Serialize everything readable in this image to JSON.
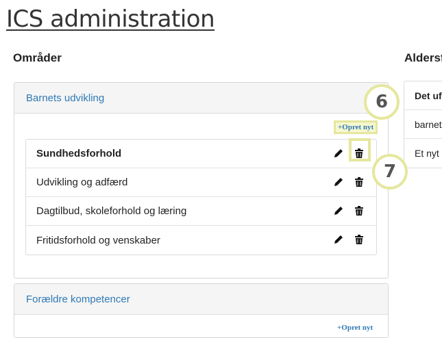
{
  "page": {
    "title": "ICS administration"
  },
  "sections": {
    "areas_heading": "Områder",
    "age_heading": "Aldersf"
  },
  "panels": [
    {
      "title": "Barnets udvikling",
      "create_label": "+Opret nyt",
      "items": [
        {
          "label": "Sundhedsforhold"
        },
        {
          "label": "Udvikling og adfærd"
        },
        {
          "label": "Dagtilbud, skoleforhold og læring"
        },
        {
          "label": "Fritidsforhold og venskaber"
        }
      ]
    },
    {
      "title": "Forældre kompetencer",
      "create_label": "+Opret nyt"
    }
  ],
  "right_panel": {
    "rows": [
      "Det uf",
      "barnet",
      "Et nyt"
    ]
  },
  "annotations": {
    "badge_6": "6",
    "badge_7": "7",
    "highlight_color": "#e5e79d"
  },
  "icons": {
    "edit": "pencil-icon",
    "delete": "trash-icon"
  }
}
